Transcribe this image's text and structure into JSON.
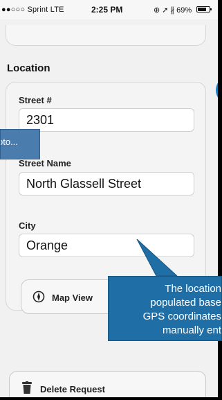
{
  "status_bar": {
    "carrier": "Sprint",
    "network": "LTE",
    "time": "2:25 PM",
    "battery": "69%"
  },
  "section": {
    "title": "Location"
  },
  "fields": {
    "street_number": {
      "label": "Street #",
      "value": "2301"
    },
    "street_name": {
      "label": "Street Name",
      "value": "North Glassell Street"
    },
    "city": {
      "label": "City",
      "value": "Orange"
    }
  },
  "buttons": {
    "map_view": "Map View",
    "delete_request": "Delete Request"
  },
  "callouts": {
    "left_fragment": "oto...",
    "main_lines": [
      "The location",
      "populated base",
      "GPS coordinates",
      "manually ent"
    ]
  },
  "colors": {
    "callout_blue": "#1f6ea6",
    "accent_blue": "#1d7fc2"
  }
}
